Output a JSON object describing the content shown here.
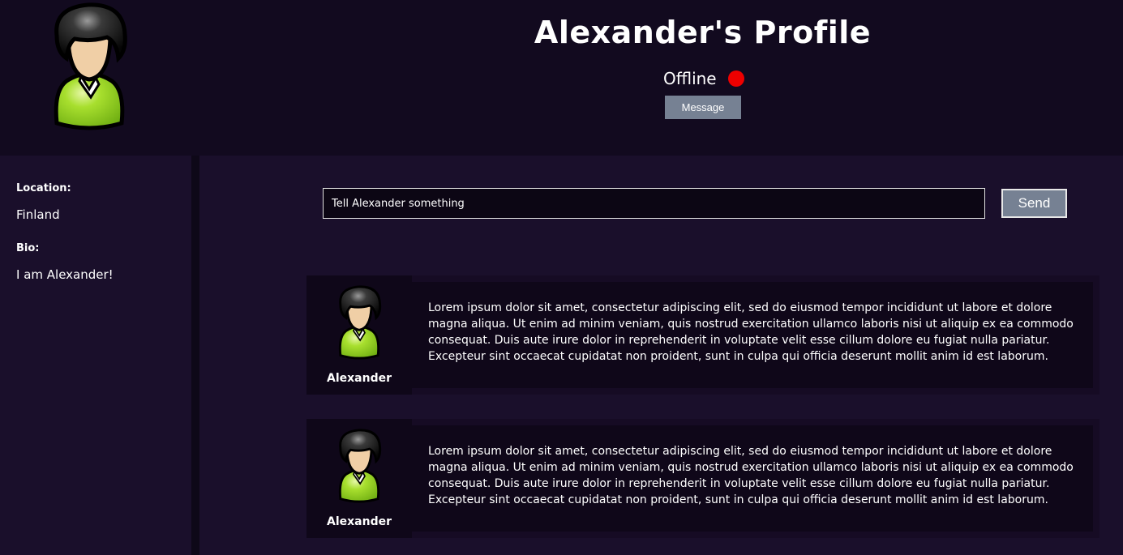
{
  "profile": {
    "title": "Alexander's Profile",
    "status": "Offline",
    "status_color": "#ee0000",
    "message_button": "Message",
    "avatar_icon": "user-avatar-icon"
  },
  "sidebar": {
    "location_label": "Location:",
    "location_value": "Finland",
    "bio_label": "Bio:",
    "bio_value": "I am Alexander!"
  },
  "composer": {
    "input_placeholder": "Tell Alexander something",
    "send_button": "Send"
  },
  "posts": [
    {
      "author": "Alexander",
      "text": "Lorem ipsum dolor sit amet, consectetur adipiscing elit, sed do eiusmod tempor incididunt ut labore et dolore magna aliqua. Ut enim ad minim veniam, quis nostrud exercitation ullamco laboris nisi ut aliquip ex ea commodo consequat. Duis aute irure dolor in reprehenderit in voluptate velit esse cillum dolore eu fugiat nulla pariatur. Excepteur sint occaecat cupidatat non proident, sunt in culpa qui officia deserunt mollit anim id est laborum."
    },
    {
      "author": "Alexander",
      "text": "Lorem ipsum dolor sit amet, consectetur adipiscing elit, sed do eiusmod tempor incididunt ut labore et dolore magna aliqua. Ut enim ad minim veniam, quis nostrud exercitation ullamco laboris nisi ut aliquip ex ea commodo consequat. Duis aute irure dolor in reprehenderit in voluptate velit esse cillum dolore eu fugiat nulla pariatur. Excepteur sint occaecat cupidatat non proident, sunt in culpa qui officia deserunt mollit anim id est laborum."
    }
  ],
  "colors": {
    "background": "#1a0f2b",
    "header": "#120a1f",
    "button": "#768193",
    "avatar_shirt": "#8fd11e",
    "avatar_hair": "#111111",
    "avatar_skin": "#f0cfa6"
  }
}
